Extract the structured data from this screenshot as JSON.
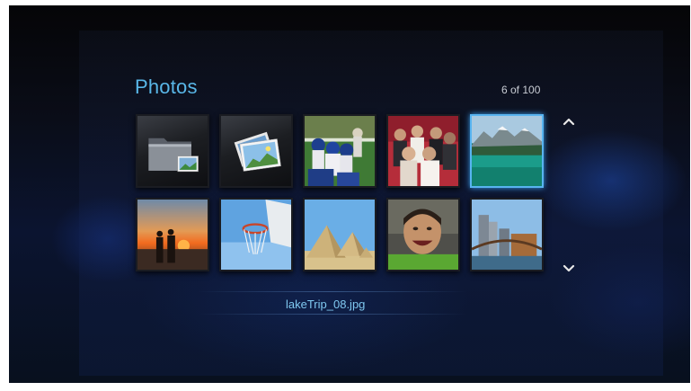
{
  "header": {
    "title": "Photos",
    "counter": "6 of 100"
  },
  "footer": {
    "filename": "lakeTrip_08.jpg"
  },
  "grid": {
    "tiles": [
      {
        "kind": "folder",
        "icon": "folder-icon"
      },
      {
        "kind": "slideshow",
        "icon": "photo-stack-icon"
      },
      {
        "kind": "photo",
        "subject": "football players"
      },
      {
        "kind": "photo",
        "subject": "group of friends"
      },
      {
        "kind": "photo",
        "subject": "mountain lake",
        "selected": true
      },
      {
        "kind": "photo",
        "subject": "couple at sunset"
      },
      {
        "kind": "photo",
        "subject": "basketball hoop"
      },
      {
        "kind": "photo",
        "subject": "pyramids"
      },
      {
        "kind": "photo",
        "subject": "smiling boy"
      },
      {
        "kind": "photo",
        "subject": "city skyline"
      }
    ]
  },
  "navigation": {
    "up_icon": "chevron-up-icon",
    "down_icon": "chevron-down-icon"
  },
  "colors": {
    "accent": "#59b7e8",
    "selection": "#58b4f0"
  }
}
